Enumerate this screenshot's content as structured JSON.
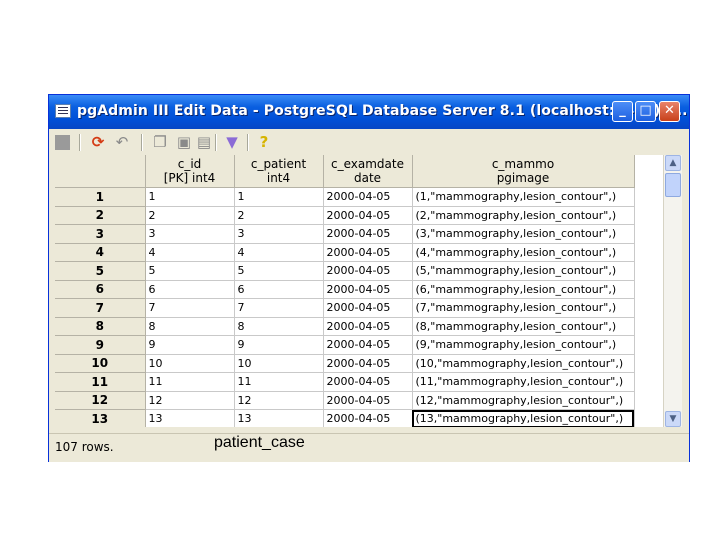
{
  "window": {
    "title": "pgAdmin III Edit Data - PostgreSQL Database Server 8.1 (localhost:5432) -...",
    "minimize": "_",
    "maximize": "□",
    "close": "✕"
  },
  "toolbar": {
    "icons": [
      "save-icon",
      "refresh-icon",
      "undo-icon",
      "copy-icon",
      "paste-icon",
      "delete-icon",
      "filter-icon",
      "help-icon"
    ],
    "help_label": "?"
  },
  "table": {
    "columns": [
      {
        "name": "c_id",
        "type": "[PK] int4"
      },
      {
        "name": "c_patient",
        "type": "int4"
      },
      {
        "name": "c_examdate",
        "type": "date"
      },
      {
        "name": "c_mammo",
        "type": "pgimage"
      }
    ],
    "rows": [
      {
        "num": "1",
        "c_id": "1",
        "c_patient": "1",
        "c_examdate": "2000-04-05",
        "c_mammo": "(1,\"mammography,lesion_contour\",)"
      },
      {
        "num": "2",
        "c_id": "2",
        "c_patient": "2",
        "c_examdate": "2000-04-05",
        "c_mammo": "(2,\"mammography,lesion_contour\",)"
      },
      {
        "num": "3",
        "c_id": "3",
        "c_patient": "3",
        "c_examdate": "2000-04-05",
        "c_mammo": "(3,\"mammography,lesion_contour\",)"
      },
      {
        "num": "4",
        "c_id": "4",
        "c_patient": "4",
        "c_examdate": "2000-04-05",
        "c_mammo": "(4,\"mammography,lesion_contour\",)"
      },
      {
        "num": "5",
        "c_id": "5",
        "c_patient": "5",
        "c_examdate": "2000-04-05",
        "c_mammo": "(5,\"mammography,lesion_contour\",)"
      },
      {
        "num": "6",
        "c_id": "6",
        "c_patient": "6",
        "c_examdate": "2000-04-05",
        "c_mammo": "(6,\"mammography,lesion_contour\",)"
      },
      {
        "num": "7",
        "c_id": "7",
        "c_patient": "7",
        "c_examdate": "2000-04-05",
        "c_mammo": "(7,\"mammography,lesion_contour\",)"
      },
      {
        "num": "8",
        "c_id": "8",
        "c_patient": "8",
        "c_examdate": "2000-04-05",
        "c_mammo": "(8,\"mammography,lesion_contour\",)"
      },
      {
        "num": "9",
        "c_id": "9",
        "c_patient": "9",
        "c_examdate": "2000-04-05",
        "c_mammo": "(9,\"mammography,lesion_contour\",)"
      },
      {
        "num": "10",
        "c_id": "10",
        "c_patient": "10",
        "c_examdate": "2000-04-05",
        "c_mammo": "(10,\"mammography,lesion_contour\",)"
      },
      {
        "num": "11",
        "c_id": "11",
        "c_patient": "11",
        "c_examdate": "2000-04-05",
        "c_mammo": "(11,\"mammography,lesion_contour\",)"
      },
      {
        "num": "12",
        "c_id": "12",
        "c_patient": "12",
        "c_examdate": "2000-04-05",
        "c_mammo": "(12,\"mammography,lesion_contour\",)"
      },
      {
        "num": "13",
        "c_id": "13",
        "c_patient": "13",
        "c_examdate": "2000-04-05",
        "c_mammo": "(13,\"mammography,lesion_contour\",)"
      }
    ],
    "selected_cell": {
      "row": 13,
      "column": "c_mammo"
    }
  },
  "status": {
    "text": "107 rows."
  },
  "caption": "patient_case",
  "colors": {
    "titlebar": "#0a5fe0",
    "window_bg": "#ece9d8",
    "grid_bg": "#ffffff"
  }
}
